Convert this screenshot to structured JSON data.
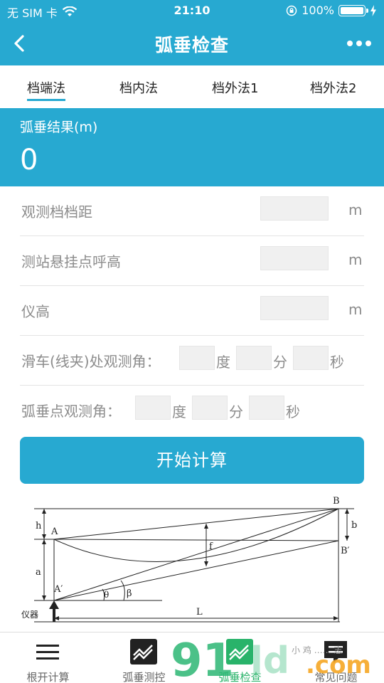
{
  "status_bar": {
    "carrier": "无 SIM 卡",
    "time": "21:10",
    "battery_percent": "100%"
  },
  "nav": {
    "title": "弧垂检查"
  },
  "tabs": [
    {
      "label": "档端法",
      "active": true
    },
    {
      "label": "档内法",
      "active": false
    },
    {
      "label": "档外法1",
      "active": false
    },
    {
      "label": "档外法2",
      "active": false
    }
  ],
  "result": {
    "label": "弧垂结果(m)",
    "value": "0"
  },
  "form": {
    "span_distance": {
      "label": "观测档档距",
      "unit": "m",
      "value": ""
    },
    "hang_point_height": {
      "label": "测站悬挂点呼高",
      "unit": "m",
      "value": ""
    },
    "instrument_height": {
      "label": "仪高",
      "unit": "m",
      "value": ""
    },
    "pulley_angle": {
      "label": "滑车(线夹)处观测角：",
      "deg": "度",
      "min": "分",
      "sec": "秒"
    },
    "sag_angle": {
      "label": "弧垂点观测角：",
      "deg": "度",
      "min": "分",
      "sec": "秒"
    }
  },
  "calc_button": "开始计算",
  "diagram": {
    "labels": {
      "A": "A",
      "B": "B",
      "A_prime": "A′",
      "B_prime": "B′",
      "h": "h",
      "a": "a",
      "b": "b",
      "f": "f",
      "L": "L",
      "theta": "θ",
      "beta": "β",
      "instrument": "仪器"
    }
  },
  "bottom_nav": [
    {
      "label": "根开计算",
      "icon": "menu-icon",
      "active": false
    },
    {
      "label": "弧垂测控",
      "icon": "sag-control-icon",
      "active": false
    },
    {
      "label": "弧垂检查",
      "icon": "sag-check-icon",
      "active": true
    },
    {
      "label": "常见问题",
      "icon": "chat-icon",
      "active": false
    }
  ],
  "watermark": {
    "text": ".com",
    "brand": "91",
    "small": "小 鸡 …… 志"
  }
}
